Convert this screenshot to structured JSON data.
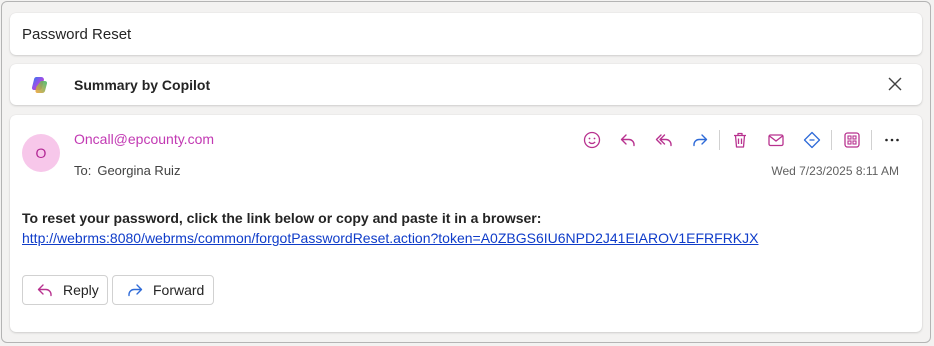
{
  "subject": "Password Reset",
  "copilot": {
    "label": "Summary by Copilot",
    "icon": "copilot-icon",
    "close_icon": "close-icon"
  },
  "message": {
    "avatar_initial": "O",
    "sender": "Oncall@epcounty.com",
    "to_label": "To:",
    "to_name": "Georgina Ruiz",
    "date": "Wed 7/23/2025 8:11 AM",
    "body_text": "To reset your password, click the link below or copy and paste it in a browser:",
    "link": "http://webrms:8080/webrms/common/forgotPasswordReset.action?token=A0ZBGS6IU6NPD2J41EIAROV1EFRFRKJX",
    "toolbar_icons": [
      "emoji-icon",
      "reply-icon",
      "reply-all-icon",
      "forward-icon",
      "delete-icon",
      "mark-unread-icon",
      "tag-icon",
      "apps-icon",
      "more-icon"
    ]
  },
  "actions": {
    "reply_label": "Reply",
    "forward_label": "Forward"
  },
  "colors": {
    "accent": "#c239b3",
    "link": "#0f3cc9",
    "avatar_bg": "#f7c7ea"
  }
}
